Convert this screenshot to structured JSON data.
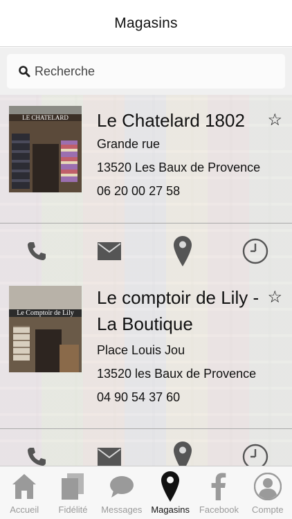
{
  "header": {
    "title": "Magasins"
  },
  "search": {
    "placeholder": "Recherche"
  },
  "stores": [
    {
      "name": "Le Chatelard 1802",
      "favorite_icon": "star-outline-icon",
      "address": "Grande rue",
      "city": "13520 Les Baux de Provence",
      "phone": "06 20 00 27 58",
      "photo_sign": "LE CHATELARD"
    },
    {
      "name": "Le comptoir de Lily - La Boutique",
      "favorite_icon": "star-outline-icon",
      "address": "Place Louis Jou",
      "city": "13520 les Baux de Provence",
      "phone": "04 90 54 37 60",
      "photo_sign": "Le Comptoir de Lily"
    }
  ],
  "actions": [
    "phone-icon",
    "mail-icon",
    "location-pin-icon",
    "clock-icon"
  ],
  "tabbar": {
    "tabs": [
      {
        "label": "Accueil",
        "icon": "home-icon",
        "active": false
      },
      {
        "label": "Fidélité",
        "icon": "cards-icon",
        "active": false
      },
      {
        "label": "Messages",
        "icon": "chat-bubble-icon",
        "active": false
      },
      {
        "label": "Magasins",
        "icon": "location-pin-icon",
        "active": true
      },
      {
        "label": "Facebook",
        "icon": "facebook-icon",
        "active": false
      },
      {
        "label": "Compte",
        "icon": "user-account-icon",
        "active": false
      }
    ]
  },
  "colors": {
    "icon_gray": "#555555",
    "inactive_tab": "#9a9a9a",
    "active_tab": "#111111"
  }
}
